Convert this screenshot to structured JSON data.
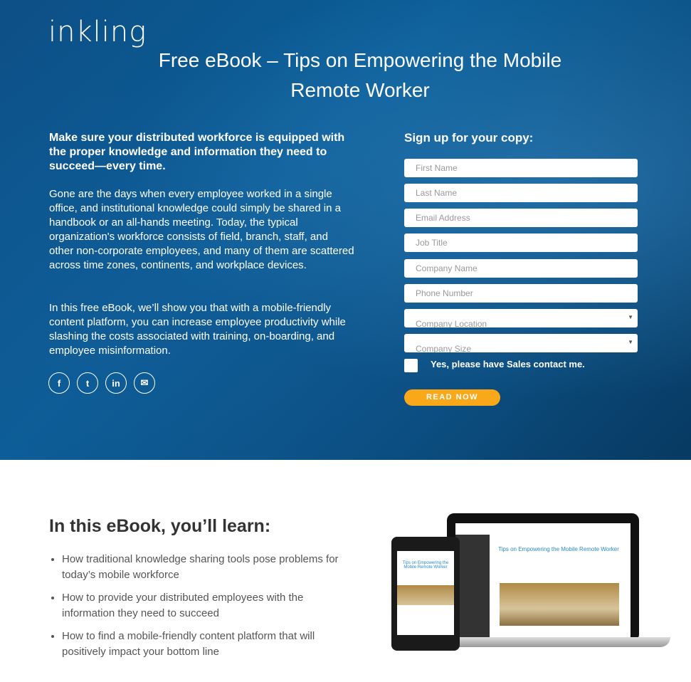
{
  "brand": "inkling",
  "title": "Free eBook – Tips on Empowering the Mobile Remote Worker",
  "lead": "Make sure your distributed workforce is equipped with the proper knowledge and information they need to succeed—every time.",
  "para1": "Gone are the days when every employee worked in a single office, and institutional knowledge could simply be shared in a handbook or an all-hands meeting. Today, the typical organization's workforce consists of field, branch, staff, and other non-corporate employees, and many of them are scattered across time zones, continents, and workplace devices.",
  "para2": "In this free eBook, we’ll show you that with a mobile-friendly content platform, you can increase employee productivity while slashing the costs associated with training, on-boarding, and employee misinformation.",
  "social": [
    {
      "icon": "facebook-icon",
      "glyph": "f"
    },
    {
      "icon": "twitter-icon",
      "glyph": "t"
    },
    {
      "icon": "linkedin-icon",
      "glyph": "in"
    },
    {
      "icon": "email-icon",
      "glyph": "✉"
    }
  ],
  "form": {
    "heading": "Sign up for your copy:",
    "fields": [
      "First Name",
      "Last Name",
      "Email Address",
      "Job Title",
      "Company Name",
      "Phone Number"
    ],
    "selects": [
      "Company Location",
      "Company Size"
    ],
    "checkbox_label": "Yes, please have Sales contact me.",
    "submit": "READ NOW"
  },
  "learn": {
    "heading": "In this eBook, you’ll learn:",
    "items": [
      "How traditional knowledge sharing tools pose problems for today’s mobile workforce",
      "How to provide your distributed employees with the information they need to succeed",
      "How to find a mobile-friendly content platform that will positively impact your bottom line"
    ]
  },
  "mockup": {
    "title": "Tips on Empowering the Mobile Remote Worker"
  },
  "colors": {
    "accent": "#f9a81a",
    "hero": "#0b5e98"
  }
}
